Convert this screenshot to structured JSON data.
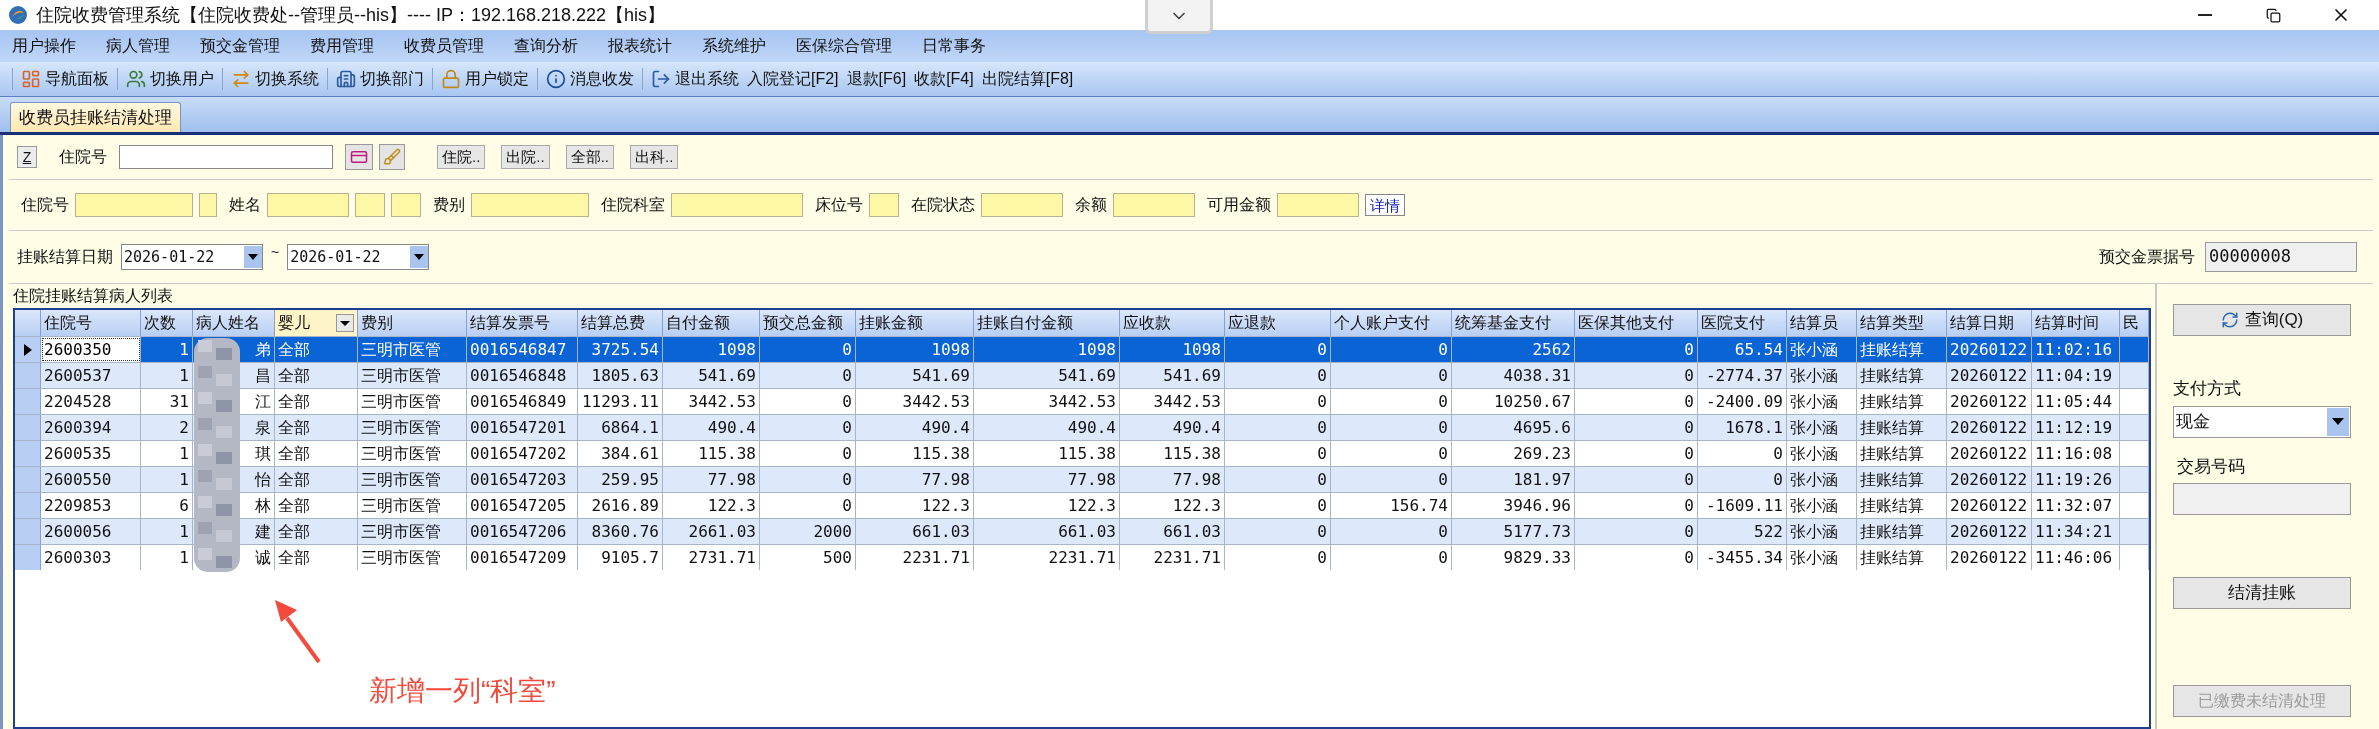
{
  "window": {
    "title": "住院收费管理系统【住院收费处--管理员--his】---- IP：192.168.218.222【his】"
  },
  "menu": [
    "用户操作",
    "病人管理",
    "预交金管理",
    "费用管理",
    "收费员管理",
    "查询分析",
    "报表统计",
    "系统维护",
    "医保综合管理",
    "日常事务"
  ],
  "toolbar": [
    {
      "label": "导航面板",
      "kind": "icon"
    },
    {
      "label": "切换用户",
      "kind": "icon"
    },
    {
      "label": "切换系统",
      "kind": "icon"
    },
    {
      "label": "切换部门",
      "kind": "icon"
    },
    {
      "label": "用户锁定",
      "kind": "icon"
    },
    {
      "label": "消息收发",
      "kind": "icon"
    },
    {
      "label": "退出系统",
      "kind": "icon"
    },
    {
      "label": "入院登记[F2]",
      "kind": "text"
    },
    {
      "label": "退款[F6]",
      "kind": "text"
    },
    {
      "label": "收款[F4]",
      "kind": "text"
    },
    {
      "label": "出院结算[F8]",
      "kind": "text"
    }
  ],
  "tabs": [
    {
      "label": "收费员挂账结清处理",
      "selected": true
    }
  ],
  "search": {
    "z_button": "Z",
    "label": "住院号",
    "buttons": [
      "住院..",
      "出院..",
      "全部..",
      "出科.."
    ]
  },
  "info_row": [
    {
      "kind": "label",
      "text": "住院号"
    },
    {
      "kind": "field"
    },
    {
      "kind": "field"
    },
    {
      "kind": "label",
      "text": "姓名"
    },
    {
      "kind": "field"
    },
    {
      "kind": "field"
    },
    {
      "kind": "field"
    },
    {
      "kind": "label",
      "text": "费别"
    },
    {
      "kind": "field"
    },
    {
      "kind": "label",
      "text": "住院科室"
    },
    {
      "kind": "field"
    },
    {
      "kind": "label",
      "text": "床位号"
    },
    {
      "kind": "field"
    },
    {
      "kind": "label",
      "text": "在院状态"
    },
    {
      "kind": "field"
    },
    {
      "kind": "label",
      "text": "余额"
    },
    {
      "kind": "field"
    },
    {
      "kind": "label",
      "text": "可用金额"
    },
    {
      "kind": "field"
    },
    {
      "kind": "link",
      "text": "详情"
    }
  ],
  "date_range": {
    "label": "挂账结算日期",
    "from": "2026-01-22",
    "separator": "~",
    "to": "2026-01-22"
  },
  "receipt": {
    "label": "预交金票据号",
    "value": "00000008"
  },
  "list_title": "住院挂账结算病人列表",
  "table": {
    "columns": [
      {
        "label": "住院号",
        "filter": false
      },
      {
        "label": "次数",
        "filter": false
      },
      {
        "label": "病人姓名",
        "filter": false
      },
      {
        "label": "婴儿",
        "filter": true
      },
      {
        "label": "费别",
        "filter": false
      },
      {
        "label": "结算发票号",
        "filter": false
      },
      {
        "label": "结算总费",
        "filter": false
      },
      {
        "label": "自付金额",
        "filter": false
      },
      {
        "label": "预交总金额",
        "filter": false
      },
      {
        "label": "挂账金额",
        "filter": false
      },
      {
        "label": "挂账自付金额",
        "filter": false
      },
      {
        "label": "应收款",
        "filter": false
      },
      {
        "label": "应退款",
        "filter": false
      },
      {
        "label": "个人账户支付",
        "filter": false
      },
      {
        "label": "统筹基金支付",
        "filter": false
      },
      {
        "label": "医保其他支付",
        "filter": false
      },
      {
        "label": "医院支付",
        "filter": false
      },
      {
        "label": "结算员",
        "filter": false
      },
      {
        "label": "结算类型",
        "filter": false
      },
      {
        "label": "结算日期",
        "filter": false
      },
      {
        "label": "结算时间",
        "filter": false
      },
      {
        "label": "民",
        "filter": false
      }
    ],
    "rows": [
      {
        "selected": true,
        "cells": [
          "2600350",
          "1",
          "弟",
          "全部",
          "三明市医管",
          "0016546847",
          "3725.54",
          "1098",
          "0",
          "1098",
          "1098",
          "1098",
          "0",
          "0",
          "2562",
          "0",
          "65.54",
          "张小涵",
          "挂账结算",
          "20260122",
          "11:02:16"
        ]
      },
      {
        "selected": false,
        "cells": [
          "2600537",
          "1",
          "昌",
          "全部",
          "三明市医管",
          "0016546848",
          "1805.63",
          "541.69",
          "0",
          "541.69",
          "541.69",
          "541.69",
          "0",
          "0",
          "4038.31",
          "0",
          "-2774.37",
          "张小涵",
          "挂账结算",
          "20260122",
          "11:04:19"
        ]
      },
      {
        "selected": false,
        "cells": [
          "2204528",
          "31",
          "江",
          "全部",
          "三明市医管",
          "0016546849",
          "11293.11",
          "3442.53",
          "0",
          "3442.53",
          "3442.53",
          "3442.53",
          "0",
          "0",
          "10250.67",
          "0",
          "-2400.09",
          "张小涵",
          "挂账结算",
          "20260122",
          "11:05:44"
        ]
      },
      {
        "selected": false,
        "cells": [
          "2600394",
          "2",
          "泉",
          "全部",
          "三明市医管",
          "0016547201",
          "6864.1",
          "490.4",
          "0",
          "490.4",
          "490.4",
          "490.4",
          "0",
          "0",
          "4695.6",
          "0",
          "1678.1",
          "张小涵",
          "挂账结算",
          "20260122",
          "11:12:19"
        ]
      },
      {
        "selected": false,
        "cells": [
          "2600535",
          "1",
          "琪",
          "全部",
          "三明市医管",
          "0016547202",
          "384.61",
          "115.38",
          "0",
          "115.38",
          "115.38",
          "115.38",
          "0",
          "0",
          "269.23",
          "0",
          "0",
          "张小涵",
          "挂账结算",
          "20260122",
          "11:16:08"
        ]
      },
      {
        "selected": false,
        "cells": [
          "2600550",
          "1",
          "怡",
          "全部",
          "三明市医管",
          "0016547203",
          "259.95",
          "77.98",
          "0",
          "77.98",
          "77.98",
          "77.98",
          "0",
          "0",
          "181.97",
          "0",
          "0",
          "张小涵",
          "挂账结算",
          "20260122",
          "11:19:26"
        ]
      },
      {
        "selected": false,
        "cells": [
          "2209853",
          "6",
          "林",
          "全部",
          "三明市医管",
          "0016547205",
          "2616.89",
          "122.3",
          "0",
          "122.3",
          "122.3",
          "122.3",
          "0",
          "156.74",
          "3946.96",
          "0",
          "-1609.11",
          "张小涵",
          "挂账结算",
          "20260122",
          "11:32:07"
        ]
      },
      {
        "selected": false,
        "cells": [
          "2600056",
          "1",
          "建",
          "全部",
          "三明市医管",
          "0016547206",
          "8360.76",
          "2661.03",
          "2000",
          "661.03",
          "661.03",
          "661.03",
          "0",
          "0",
          "5177.73",
          "0",
          "522",
          "张小涵",
          "挂账结算",
          "20260122",
          "11:34:21"
        ]
      },
      {
        "selected": false,
        "cells": [
          "2600303",
          "1",
          "诚",
          "全部",
          "三明市医管",
          "0016547209",
          "9105.7",
          "2731.71",
          "500",
          "2231.71",
          "2231.71",
          "2231.71",
          "0",
          "0",
          "9829.33",
          "0",
          "-3455.34",
          "张小涵",
          "挂账结算",
          "20260122",
          "11:46:06"
        ]
      }
    ]
  },
  "side_panel": {
    "query_button": "查询(Q)",
    "payment_label": "支付方式",
    "payment_value": "现金",
    "txn_label": "交易号码",
    "settle_button": "结清挂账",
    "paid_button": {
      "label": "已缴费未结清处理",
      "disabled": true
    }
  },
  "annotation": {
    "text": "新增一列“科室”"
  }
}
